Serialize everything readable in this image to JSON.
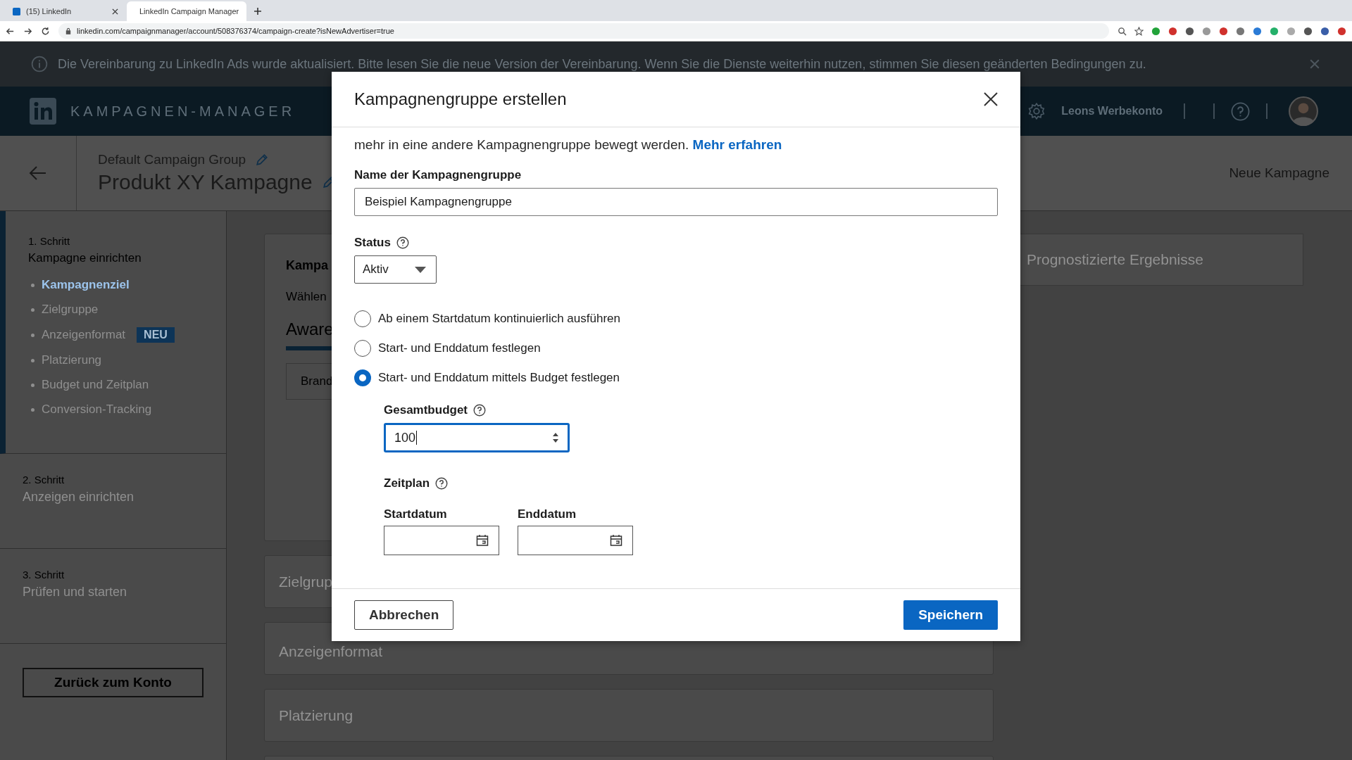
{
  "browser": {
    "tabs": [
      {
        "title": "(15) LinkedIn",
        "selected": false
      },
      {
        "title": "LinkedIn Campaign Manager",
        "selected": true
      }
    ],
    "url": "linkedin.com/campaignmanager/account/508376374/campaign-create?isNewAdvertiser=true"
  },
  "banner": {
    "text": "Die Vereinbarung zu LinkedIn Ads wurde aktualisiert. Bitte lesen Sie die neue Version der Vereinbarung. Wenn Sie die Dienste weiterhin nutzen, stimmen Sie diesen geänderten Bedingungen zu."
  },
  "header": {
    "brand": "KAMPAGNEN-MANAGER",
    "account": "Leons Werbekonto"
  },
  "campaign_header": {
    "group": "Default Campaign Group",
    "name": "Produkt XY Kampagne",
    "action": "Neue Kampagne"
  },
  "sidebar": {
    "steps": [
      {
        "step": "1. Schritt",
        "title": "Kampagne einrichten",
        "active": true,
        "items": [
          {
            "label": "Kampagnenziel",
            "selected": true
          },
          {
            "label": "Zielgruppe",
            "selected": false
          },
          {
            "label": "Anzeigenformat",
            "selected": false,
            "badge": "NEU"
          },
          {
            "label": "Platzierung",
            "selected": false
          },
          {
            "label": "Budget und Zeitplan",
            "selected": false
          },
          {
            "label": "Conversion-Tracking",
            "selected": false
          }
        ]
      },
      {
        "step": "2. Schritt",
        "title": "Anzeigen einrichten",
        "active": false
      },
      {
        "step": "3. Schritt",
        "title": "Prüfen und starten",
        "active": false
      }
    ],
    "back_button": "Zurück zum Konto"
  },
  "main": {
    "objective": {
      "title": "Kampa",
      "subtitle": "Wählen",
      "tab": "Aware",
      "option": "Brand"
    },
    "sections": [
      "Zielgrup",
      "Anzeigenformat",
      "Platzierung"
    ],
    "forecast": "Prognostizierte Ergebnisse"
  },
  "modal": {
    "title": "Kampagnengruppe erstellen",
    "intro": "mehr in eine andere Kampagnengruppe bewegt werden.",
    "intro_link": "Mehr erfahren",
    "name_label": "Name der Kampagnengruppe",
    "name_value": "Beispiel Kampagnengruppe",
    "status_label": "Status",
    "status_value": "Aktiv",
    "schedule_options": [
      {
        "label": "Ab einem Startdatum kontinuierlich ausführen",
        "selected": false
      },
      {
        "label": "Start- und Enddatum festlegen",
        "selected": false
      },
      {
        "label": "Start- und Enddatum mittels Budget festlegen",
        "selected": true
      }
    ],
    "budget_label": "Gesamtbudget",
    "budget_value": "100",
    "schedule_label": "Zeitplan",
    "start_label": "Startdatum",
    "end_label": "Enddatum",
    "cancel": "Abbrechen",
    "save": "Speichern"
  }
}
